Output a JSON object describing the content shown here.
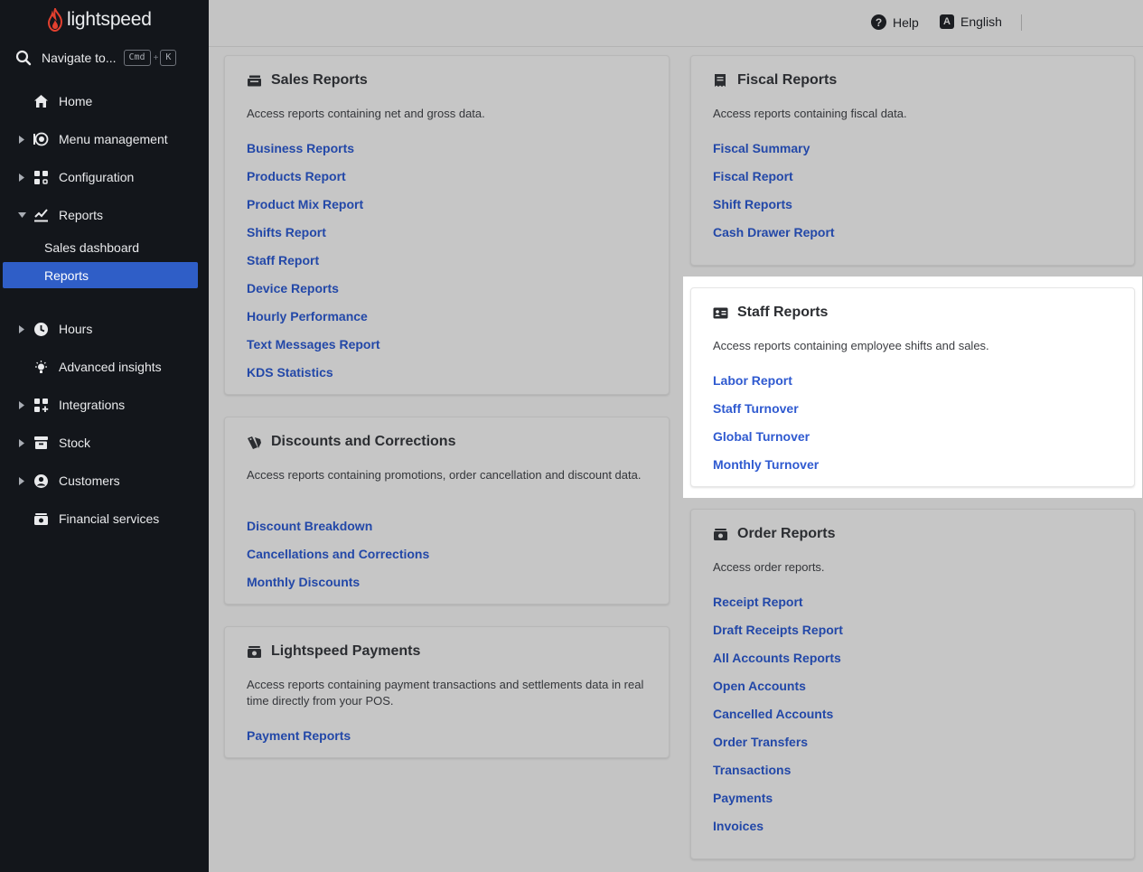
{
  "brand": {
    "name": "lightspeed",
    "accent": "#e2402f"
  },
  "sidebar": {
    "search_label": "Navigate to...",
    "shortcut_key1": "Cmd",
    "shortcut_plus": "+",
    "shortcut_key2": "K",
    "items": [
      {
        "label": "Home",
        "icon": "home-icon",
        "expandable": false
      },
      {
        "label": "Menu management",
        "icon": "menu-management-icon",
        "expandable": true
      },
      {
        "label": "Configuration",
        "icon": "configuration-icon",
        "expandable": true
      },
      {
        "label": "Reports",
        "icon": "reports-icon",
        "expandable": true,
        "expanded": true
      },
      {
        "label": "Hours",
        "icon": "clock-icon",
        "expandable": true
      },
      {
        "label": "Advanced insights",
        "icon": "lightbulb-icon",
        "expandable": false
      },
      {
        "label": "Integrations",
        "icon": "integrations-icon",
        "expandable": true
      },
      {
        "label": "Stock",
        "icon": "stock-icon",
        "expandable": true
      },
      {
        "label": "Customers",
        "icon": "customer-icon",
        "expandable": true
      },
      {
        "label": "Financial services",
        "icon": "financial-icon",
        "expandable": false
      }
    ],
    "reports_sub": [
      {
        "label": "Sales dashboard",
        "active": false
      },
      {
        "label": "Reports",
        "active": true
      }
    ]
  },
  "topbar": {
    "help": "Help",
    "language": "English",
    "language_badge": "A",
    "help_badge": "?"
  },
  "cards": {
    "sales": {
      "title": "Sales Reports",
      "description": "Access reports containing net and gross data.",
      "links": [
        "Business Reports",
        "Products Report",
        "Product Mix Report",
        "Shifts Report",
        "Staff Report",
        "Device Reports",
        "Hourly Performance",
        "Text Messages Report",
        "KDS Statistics"
      ]
    },
    "discounts": {
      "title": "Discounts and Corrections",
      "description": "Access reports containing promotions, order cancellation and discount data.",
      "links": [
        "Discount Breakdown",
        "Cancellations and Corrections",
        "Monthly Discounts"
      ]
    },
    "payments": {
      "title": "Lightspeed Payments",
      "description": "Access reports containing payment transactions and settlements data in real time directly from your POS.",
      "links": [
        "Payment Reports"
      ]
    },
    "fiscal": {
      "title": "Fiscal Reports",
      "description": "Access reports containing fiscal data.",
      "links": [
        "Fiscal Summary",
        "Fiscal Report",
        "Shift Reports",
        "Cash Drawer Report"
      ]
    },
    "staff": {
      "title": "Staff Reports",
      "description": "Access reports containing employee shifts and sales.",
      "links": [
        "Labor Report",
        "Staff Turnover",
        "Global Turnover",
        "Monthly Turnover"
      ]
    },
    "orders": {
      "title": "Order Reports",
      "description": "Access order reports.",
      "links": [
        "Receipt Report",
        "Draft Receipts Report",
        "All Accounts Reports",
        "Open Accounts",
        "Cancelled Accounts",
        "Order Transfers",
        "Transactions",
        "Payments",
        "Invoices"
      ]
    }
  }
}
